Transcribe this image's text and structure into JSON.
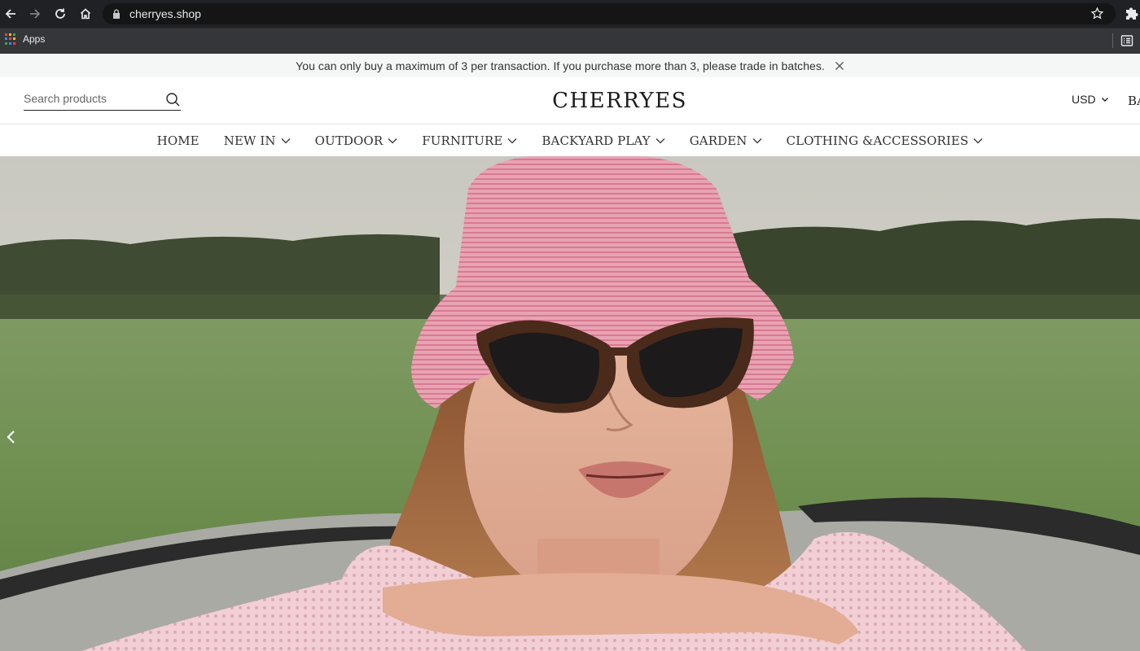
{
  "browser": {
    "url": "cherryes.shop",
    "bookmarks_apps_label": "Apps"
  },
  "announcement": {
    "text": "You can only buy a maximum of 3 per transaction. If you purchase more than 3, please trade in batches."
  },
  "header": {
    "search_placeholder": "Search products",
    "logo": "CHERRYES",
    "currency": "USD",
    "cut_off_text": "BA"
  },
  "nav": {
    "items": [
      {
        "label": "HOME",
        "dropdown": false
      },
      {
        "label": "NEW IN",
        "dropdown": true
      },
      {
        "label": "OUTDOOR",
        "dropdown": true
      },
      {
        "label": "FURNITURE",
        "dropdown": true
      },
      {
        "label": "BACKYARD PLAY",
        "dropdown": true
      },
      {
        "label": "GARDEN",
        "dropdown": true
      },
      {
        "label": "CLOTHING &ACCESSORIES",
        "dropdown": true
      }
    ]
  },
  "icons": {
    "back": "back-arrow-icon",
    "forward": "forward-arrow-icon",
    "reload": "reload-icon",
    "home": "home-icon",
    "lock": "lock-icon",
    "star": "bookmark-star-icon",
    "extensions": "puzzle-icon",
    "reading_list": "reading-list-icon",
    "search": "search-icon",
    "close": "close-icon",
    "chevron": "chevron-down-icon",
    "slider_prev": "chevron-left-icon"
  },
  "colors": {
    "chrome_dark": "#202124",
    "announcement_bg": "#f4f7f6",
    "text_dark": "#1d1d1d"
  }
}
